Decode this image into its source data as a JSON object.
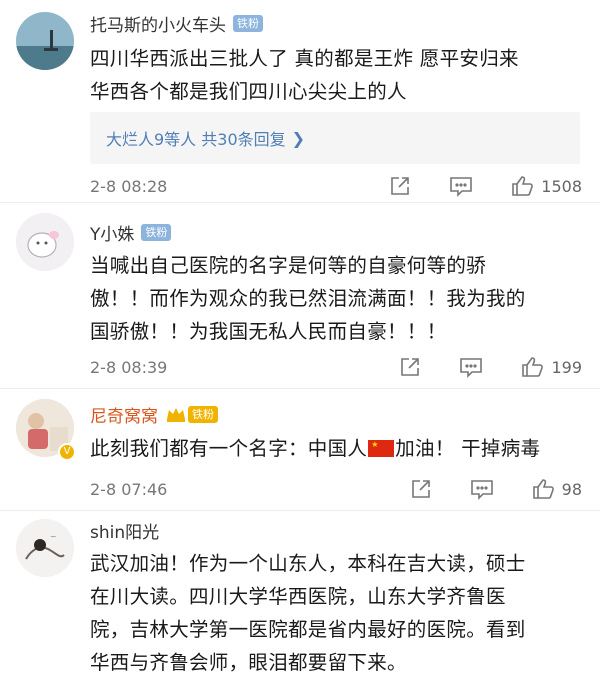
{
  "comments": [
    {
      "username": "托马斯的小火车头",
      "badge": "铁粉",
      "text_lines": [
        "四川华西派出三批人了 真的都是王炸 愿平安归来",
        "华西各个都是我们四川心尖尖上的人"
      ],
      "replies_summary": "大烂人9等人 共30条回复",
      "time": "2-8 08:28",
      "likes": "1508"
    },
    {
      "username": "Y小姝",
      "badge": "铁粉",
      "text_lines": [
        "当喊出自己医院的名字是何等的自豪何等的骄",
        "傲！！而作为观众的我已然泪流满面！！我为我的",
        "国骄傲！！为我国无私人民而自豪！！！"
      ],
      "time": "2-8 08:39",
      "likes": "199"
    },
    {
      "username": "尼奇窝窝",
      "badge": "铁粉",
      "text_before_flag": "此刻我们都有一个名字：中国人",
      "text_after_flag": "加油！ 干掉病毒",
      "time": "2-8 07:46",
      "likes": "98"
    },
    {
      "username": "shin阳光",
      "text_lines": [
        "武汉加油！作为一个山东人，本科在吉大读，硕士",
        "在川大读。四川大学华西医院，山东大学齐鲁医",
        "院，吉林大学第一医院都是省内最好的医院。看到",
        "华西与齐鲁会师，眼泪都要留下来。"
      ]
    }
  ],
  "icons": {
    "share": "share-icon",
    "reply": "comment-icon",
    "like": "thumbs-up-icon",
    "crown": "crown-icon",
    "flag": "china-flag-icon"
  },
  "colors": {
    "badge": "#8cb4dc",
    "link": "#4f7fb5",
    "crown": "#f0b400"
  }
}
